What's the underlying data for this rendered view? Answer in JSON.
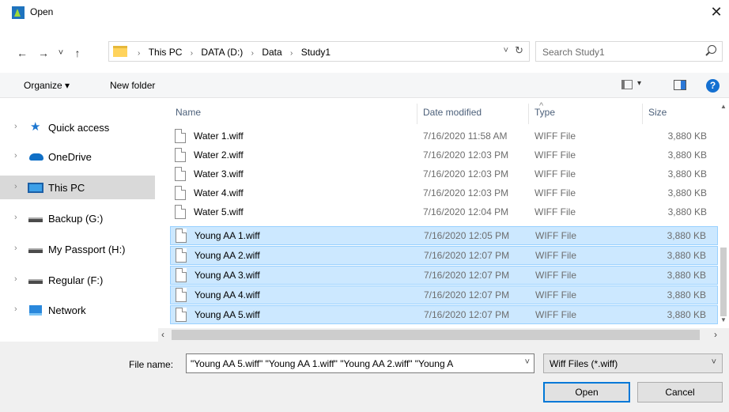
{
  "window": {
    "title": "Open",
    "close_glyph": "✕",
    "app_icon": "app-logo-icon"
  },
  "nav": {
    "back": "←",
    "forward": "→",
    "recent": "˅",
    "up": "↑"
  },
  "address": {
    "crumbs": [
      "This PC",
      "DATA (D:)",
      "Data",
      "Study1"
    ],
    "separator": "›",
    "drop": "˅",
    "refresh": "↻"
  },
  "search": {
    "placeholder": "Search Study1"
  },
  "commands": {
    "organize": "Organize ▾",
    "new_folder": "New folder",
    "view_drop": "▾",
    "help": "?"
  },
  "sidebar": {
    "items": [
      {
        "label": "Quick access",
        "icon": "star-icon"
      },
      {
        "label": "OneDrive",
        "icon": "cloud-icon"
      },
      {
        "label": "This PC",
        "icon": "computer-icon",
        "selected": true
      },
      {
        "label": "Backup (G:)",
        "icon": "drive-icon"
      },
      {
        "label": "My Passport (H:)",
        "icon": "drive-icon"
      },
      {
        "label": "Regular (F:)",
        "icon": "drive-icon"
      },
      {
        "label": "Network",
        "icon": "network-icon"
      }
    ],
    "chevron": "›"
  },
  "columns": {
    "name": "Name",
    "date": "Date modified",
    "type": "Type",
    "size": "Size",
    "sort_arrow": "^"
  },
  "files": [
    {
      "name": "Water 1.wiff",
      "date": "7/16/2020 11:58 AM",
      "type": "WIFF File",
      "size": "3,880 KB",
      "selected": false
    },
    {
      "name": "Water 2.wiff",
      "date": "7/16/2020 12:03 PM",
      "type": "WIFF File",
      "size": "3,880 KB",
      "selected": false
    },
    {
      "name": "Water 3.wiff",
      "date": "7/16/2020 12:03 PM",
      "type": "WIFF File",
      "size": "3,880 KB",
      "selected": false
    },
    {
      "name": "Water 4.wiff",
      "date": "7/16/2020 12:03 PM",
      "type": "WIFF File",
      "size": "3,880 KB",
      "selected": false
    },
    {
      "name": "Water 5.wiff",
      "date": "7/16/2020 12:04 PM",
      "type": "WIFF File",
      "size": "3,880 KB",
      "selected": false
    },
    {
      "name": "Young AA 1.wiff",
      "date": "7/16/2020 12:05 PM",
      "type": "WIFF File",
      "size": "3,880 KB",
      "selected": true
    },
    {
      "name": "Young AA 2.wiff",
      "date": "7/16/2020 12:07 PM",
      "type": "WIFF File",
      "size": "3,880 KB",
      "selected": true
    },
    {
      "name": "Young AA 3.wiff",
      "date": "7/16/2020 12:07 PM",
      "type": "WIFF File",
      "size": "3,880 KB",
      "selected": true
    },
    {
      "name": "Young AA 4.wiff",
      "date": "7/16/2020 12:07 PM",
      "type": "WIFF File",
      "size": "3,880 KB",
      "selected": true
    },
    {
      "name": "Young AA 5.wiff",
      "date": "7/16/2020 12:07 PM",
      "type": "WIFF File",
      "size": "3,880 KB",
      "selected": true
    }
  ],
  "scroll": {
    "up": "▲",
    "down": "▼",
    "left": "‹",
    "right": "›"
  },
  "footer": {
    "filename_label": "File name:",
    "filename_value": "\"Young AA 5.wiff\" \"Young AA 1.wiff\" \"Young AA 2.wiff\" \"Young A",
    "filename_drop": "˅",
    "filetype_value": "Wiff Files (*.wiff)",
    "filetype_drop": "˅",
    "open_label": "Open",
    "cancel_label": "Cancel"
  }
}
